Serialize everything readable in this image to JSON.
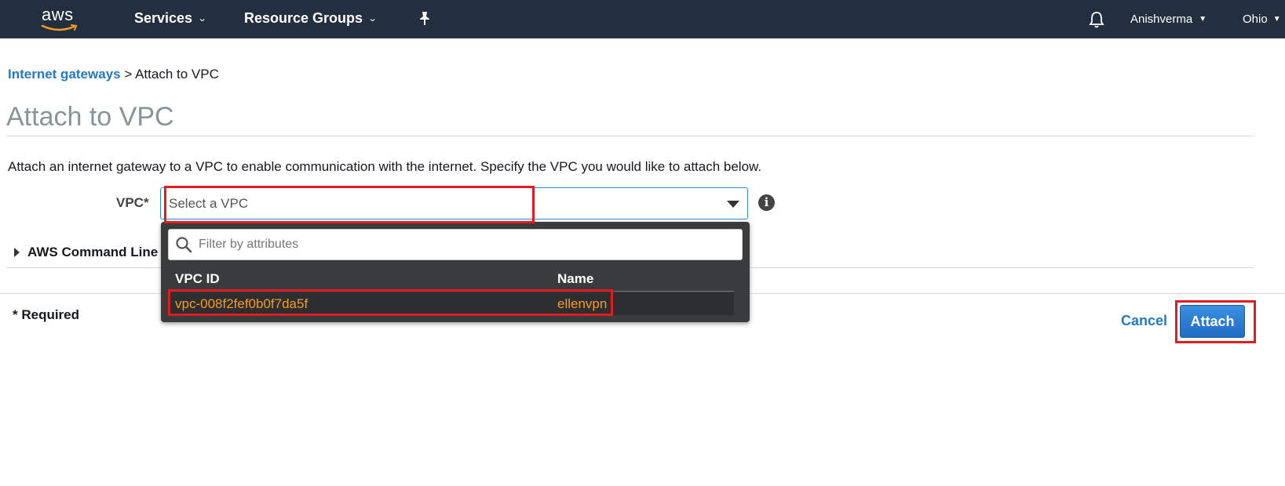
{
  "nav": {
    "logo": "aws",
    "services": "Services",
    "resource_groups": "Resource Groups",
    "user": "Anishverma",
    "region": "Ohio",
    "icons": [
      "pin-icon",
      "bell-icon",
      "chevron-down-icon"
    ]
  },
  "breadcrumb": {
    "parent": "Internet gateways",
    "separator": ">",
    "current": "Attach to VPC"
  },
  "page": {
    "title": "Attach to VPC",
    "description": "Attach an internet gateway to a VPC to enable communication with the internet. Specify the VPC you would like to attach below."
  },
  "form": {
    "vpc_label": "VPC*",
    "vpc_placeholder": "Select a VPC",
    "cli_section": "AWS Command Line",
    "required_note": "* Required"
  },
  "dropdown": {
    "filter_placeholder": "Filter by attributes",
    "columns": [
      "VPC ID",
      "Name"
    ],
    "rows": [
      {
        "vpc_id": "vpc-008f2fef0b0f7da5f",
        "name": "ellenvpn"
      }
    ]
  },
  "actions": {
    "cancel": "Cancel",
    "attach": "Attach"
  },
  "colors": {
    "nav_bg": "#232f3e",
    "link": "#2479c5",
    "highlight": "#f79a22",
    "annotation": "#e11b22"
  }
}
